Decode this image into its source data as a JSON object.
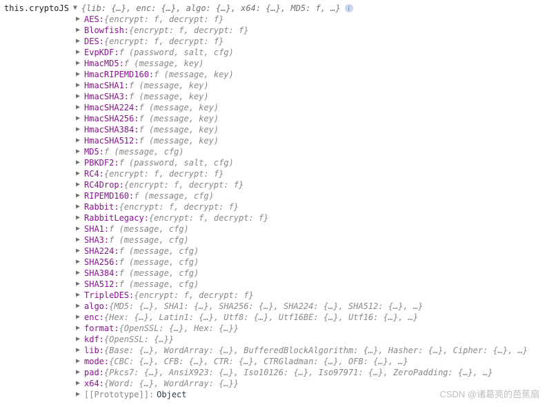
{
  "root": {
    "label": "this.cryptoJS",
    "summary": "{lib: {…}, enc: {…}, algo: {…}, x64: {…}, MD5: f, …}"
  },
  "entries": [
    {
      "key": "AES",
      "value": "{encrypt: f, decrypt: f}"
    },
    {
      "key": "Blowfish",
      "value": "{encrypt: f, decrypt: f}"
    },
    {
      "key": "DES",
      "value": "{encrypt: f, decrypt: f}"
    },
    {
      "key": "EvpKDF",
      "value": "f (password, salt, cfg)"
    },
    {
      "key": "HmacMD5",
      "value": "f (message, key)"
    },
    {
      "key": "HmacRIPEMD160",
      "value": "f (message, key)"
    },
    {
      "key": "HmacSHA1",
      "value": "f (message, key)"
    },
    {
      "key": "HmacSHA3",
      "value": "f (message, key)"
    },
    {
      "key": "HmacSHA224",
      "value": "f (message, key)"
    },
    {
      "key": "HmacSHA256",
      "value": "f (message, key)"
    },
    {
      "key": "HmacSHA384",
      "value": "f (message, key)"
    },
    {
      "key": "HmacSHA512",
      "value": "f (message, key)"
    },
    {
      "key": "MD5",
      "value": "f (message, cfg)"
    },
    {
      "key": "PBKDF2",
      "value": "f (password, salt, cfg)"
    },
    {
      "key": "RC4",
      "value": "{encrypt: f, decrypt: f}"
    },
    {
      "key": "RC4Drop",
      "value": "{encrypt: f, decrypt: f}"
    },
    {
      "key": "RIPEMD160",
      "value": "f (message, cfg)"
    },
    {
      "key": "Rabbit",
      "value": "{encrypt: f, decrypt: f}"
    },
    {
      "key": "RabbitLegacy",
      "value": "{encrypt: f, decrypt: f}"
    },
    {
      "key": "SHA1",
      "value": "f (message, cfg)"
    },
    {
      "key": "SHA3",
      "value": "f (message, cfg)"
    },
    {
      "key": "SHA224",
      "value": "f (message, cfg)"
    },
    {
      "key": "SHA256",
      "value": "f (message, cfg)"
    },
    {
      "key": "SHA384",
      "value": "f (message, cfg)"
    },
    {
      "key": "SHA512",
      "value": "f (message, cfg)"
    },
    {
      "key": "TripleDES",
      "value": "{encrypt: f, decrypt: f}"
    },
    {
      "key": "algo",
      "value": "{MD5: {…}, SHA1: {…}, SHA256: {…}, SHA224: {…}, SHA512: {…}, …}"
    },
    {
      "key": "enc",
      "value": "{Hex: {…}, Latin1: {…}, Utf8: {…}, Utf16BE: {…}, Utf16: {…}, …}"
    },
    {
      "key": "format",
      "value": "{OpenSSL: {…}, Hex: {…}}"
    },
    {
      "key": "kdf",
      "value": "{OpenSSL: {…}}"
    },
    {
      "key": "lib",
      "value": "{Base: {…}, WordArray: {…}, BufferedBlockAlgorithm: {…}, Hasher: {…}, Cipher: {…}, …}"
    },
    {
      "key": "mode",
      "value": "{CBC: {…}, CFB: {…}, CTR: {…}, CTRGladman: {…}, OFB: {…}, …}"
    },
    {
      "key": "pad",
      "value": "{Pkcs7: {…}, AnsiX923: {…}, Iso10126: {…}, Iso97971: {…}, ZeroPadding: {…}, …}"
    },
    {
      "key": "x64",
      "value": "{Word: {…}, WordArray: {…}}"
    }
  ],
  "proto": {
    "key": "[[Prototype]]",
    "value": "Object"
  },
  "watermark": "CSDN @诸葛亮的芭蕉扇"
}
